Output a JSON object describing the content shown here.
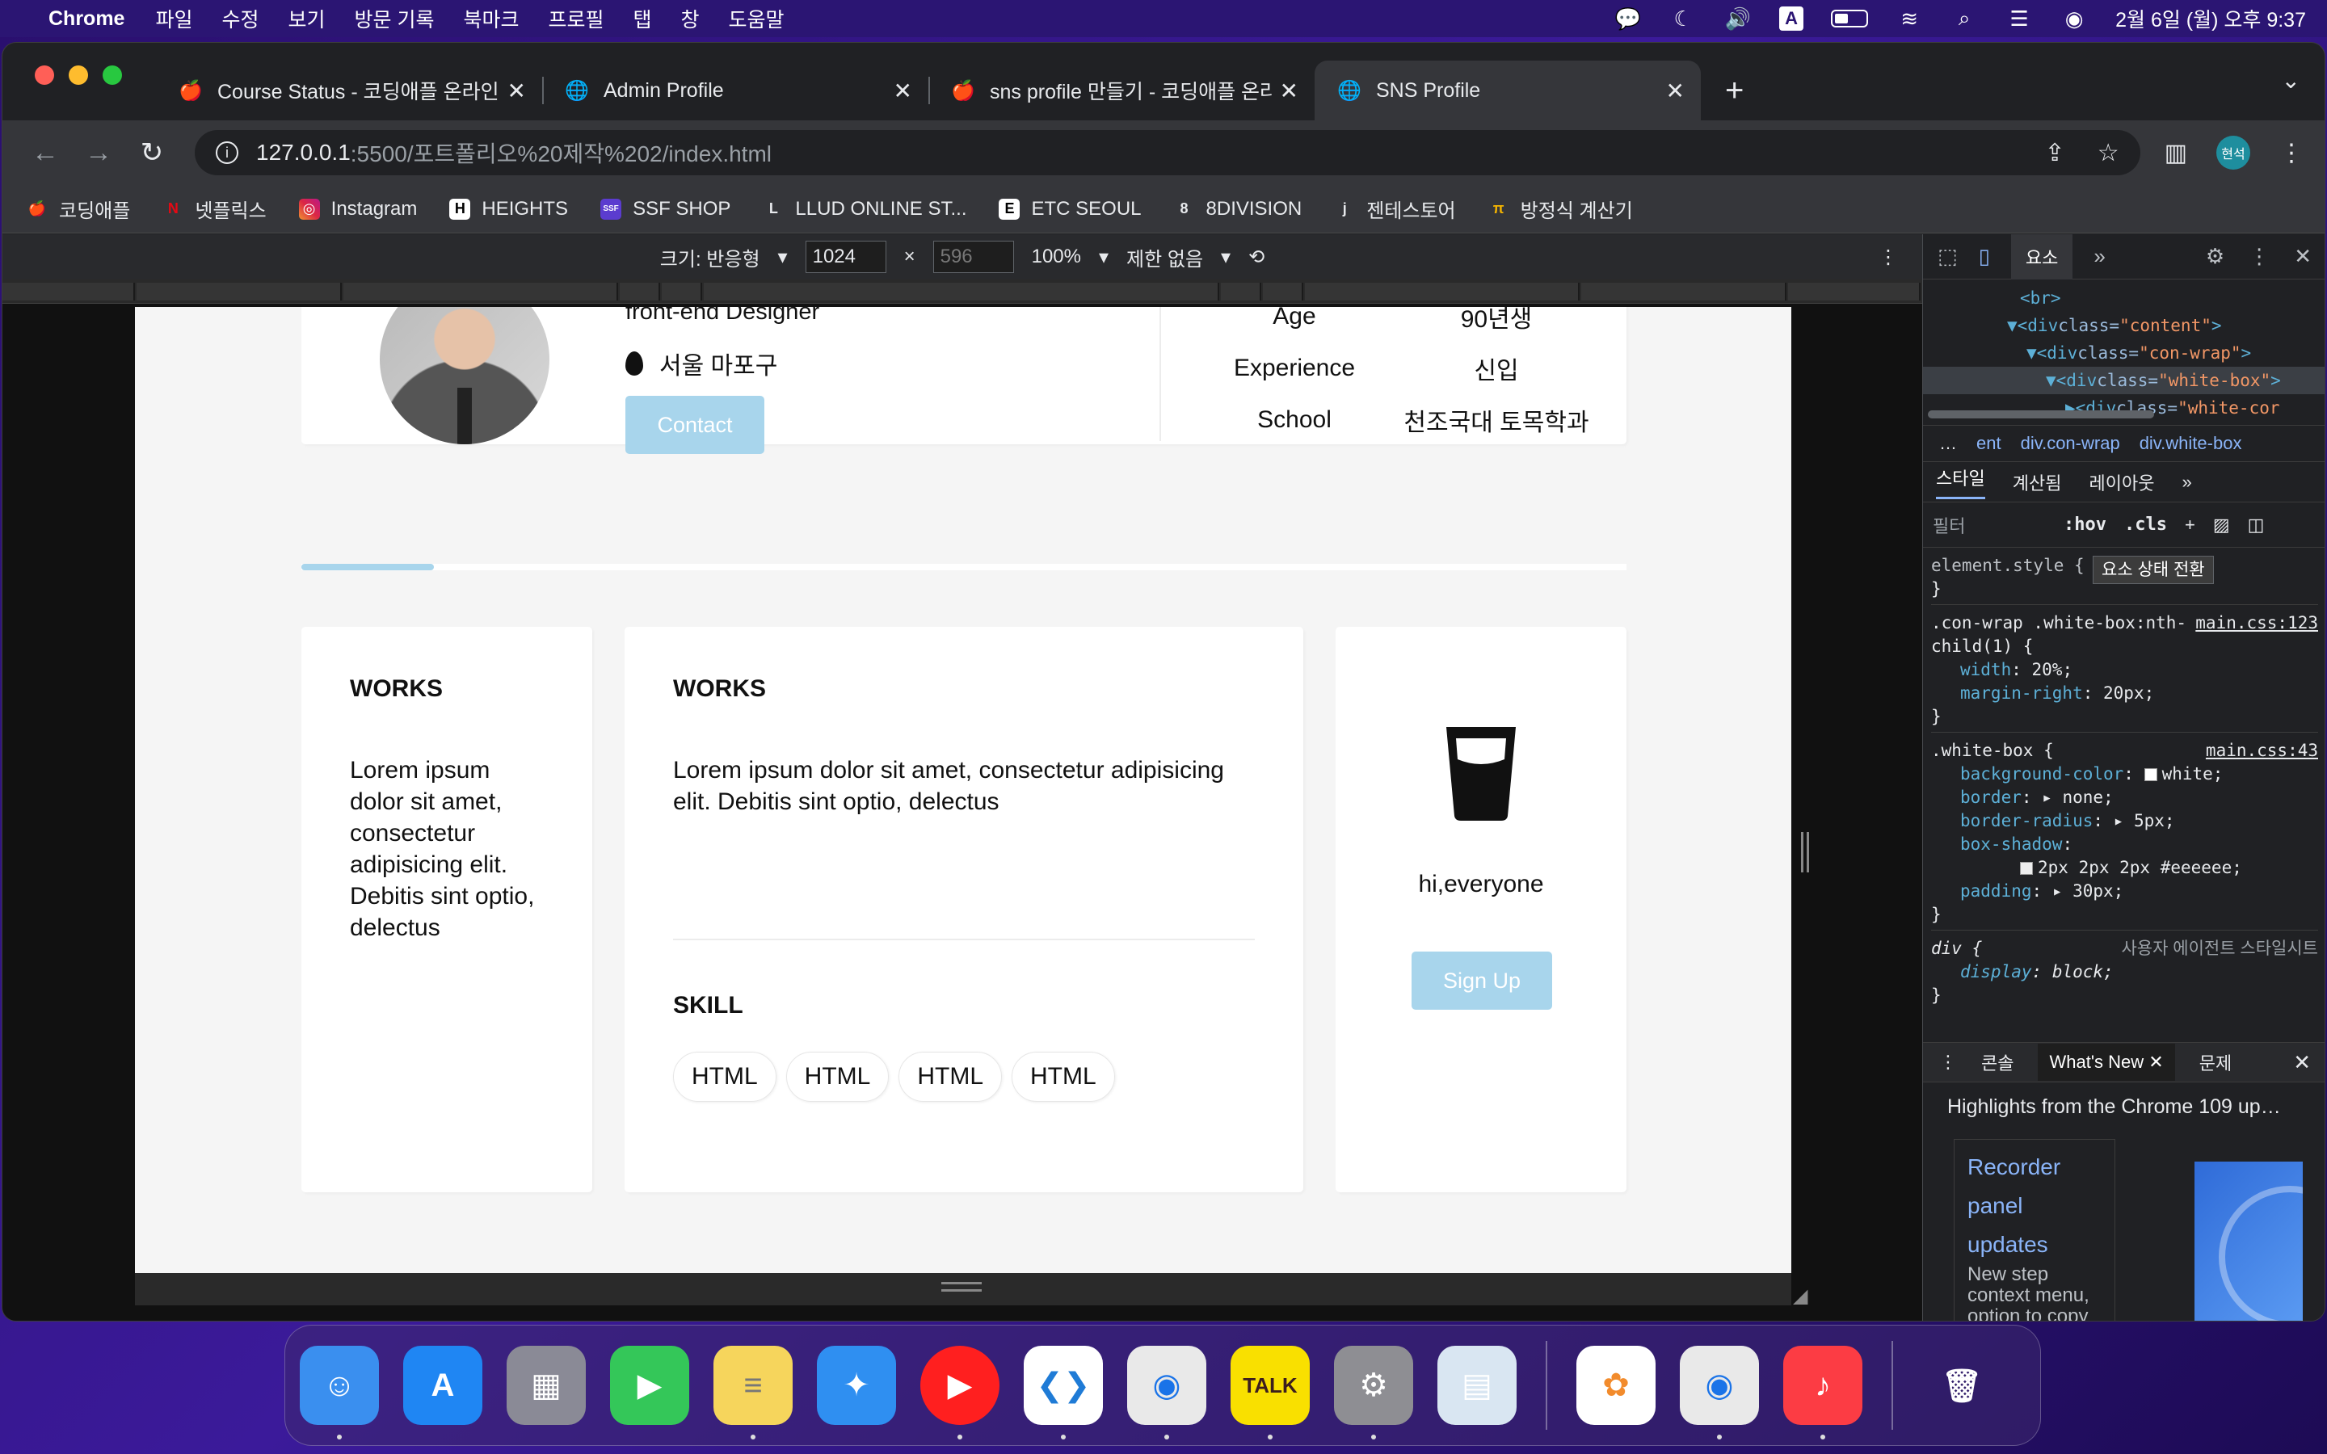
{
  "menubar": {
    "app_name": "Chrome",
    "menus": [
      "파일",
      "수정",
      "보기",
      "방문 기록",
      "북마크",
      "프로필",
      "탭",
      "창",
      "도움말"
    ],
    "clock": "2월 6일 (월) 오후 9:37",
    "input_source": "A"
  },
  "tabs": [
    {
      "title": "Course Status - 코딩애플 온라인",
      "favicon": "apple-favicon"
    },
    {
      "title": "Admin Profile",
      "favicon": "globe-favicon"
    },
    {
      "title": "sns profile 만들기 - 코딩애플 온라",
      "favicon": "apple-favicon"
    },
    {
      "title": "SNS Profile",
      "favicon": "globe-favicon"
    }
  ],
  "address": {
    "host": "127.0.0.1",
    "path": ":5500/포트폴리오%20제작%202/index.html"
  },
  "profile_avatar": "현석",
  "bookmarks": [
    {
      "label": "코딩애플",
      "icon": "🍎",
      "color": "#2b2b2b"
    },
    {
      "label": "넷플릭스",
      "icon": "N",
      "color": "#e50914"
    },
    {
      "label": "Instagram",
      "icon": "◎",
      "color": "#d6249f"
    },
    {
      "label": "HEIGHTS",
      "icon": "H",
      "color": "#ffffff"
    },
    {
      "label": "SSF SHOP",
      "icon": "SSF",
      "color": "#5b3ccf"
    },
    {
      "label": "LLUD ONLINE ST...",
      "icon": "L",
      "color": "#202124"
    },
    {
      "label": "ETC SEOUL",
      "icon": "E",
      "color": "#ffffff"
    },
    {
      "label": "8DIVISION",
      "icon": "8",
      "color": "#202124"
    },
    {
      "label": "젠테스토어",
      "icon": "j",
      "color": "#202124"
    },
    {
      "label": "방정식 계산기",
      "icon": "π",
      "color": "#202124"
    }
  ],
  "device_toolbar": {
    "size_label": "크기: 반응형",
    "width": "1024",
    "height": "596",
    "zoom": "100%",
    "throttle": "제한 없음"
  },
  "page": {
    "role": "front-end Designer",
    "location": "서울 마포구",
    "contact_label": "Contact",
    "info": [
      {
        "key": "Age",
        "value": "90년생"
      },
      {
        "key": "Experience",
        "value": "신입"
      },
      {
        "key": "School",
        "value": "천조국대 토목학과"
      }
    ],
    "progress_fraction": 0.1,
    "box_a": {
      "heading": "WORKS",
      "text": "Lorem ipsum dolor sit amet, consectetur adipisicing elit. Debitis sint optio, delectus"
    },
    "box_b": {
      "heading": "WORKS",
      "text": "Lorem ipsum dolor sit amet, consectetur adipisicing elit. Debitis sint optio, delectus",
      "skill_heading": "SKILL",
      "skills": [
        "HTML",
        "HTML",
        "HTML",
        "HTML"
      ]
    },
    "box_c": {
      "greeting": "hi,everyone",
      "signup_label": "Sign Up"
    }
  },
  "devtools": {
    "panel_tab": "요소",
    "dom": [
      {
        "indent": 0,
        "tag": "<br>"
      },
      {
        "indent": 1,
        "tag": "▼<div ",
        "attr": "class=",
        "val": "\"content\"",
        "end": ">"
      },
      {
        "indent": 2,
        "tag": "▼<div ",
        "attr": "class=",
        "val": "\"con-wrap\"",
        "end": ">"
      },
      {
        "indent": 3,
        "tag": "▼<div ",
        "attr": "class=",
        "val": "\"white-box\"",
        "end": ">"
      },
      {
        "indent": 4,
        "tag": "▶<div ",
        "attr": "class=",
        "val": "\"white-cor",
        "end": ""
      }
    ],
    "breadcrumb": [
      "…",
      "ent",
      "div.con-wrap",
      "div.white-box"
    ],
    "subtabs": [
      "스타일",
      "계산됨",
      "레이아웃"
    ],
    "filter_placeholder": "필터",
    "hov": ":hov",
    "cls": ".cls",
    "tooltip": "요소 상태 전환",
    "rules": [
      {
        "selector": "element.style {",
        "source": "",
        "props": [],
        "close": "}"
      },
      {
        "selector": ".con-wrap .white-box:nth-child(1) {",
        "source": "main.css:123",
        "props": [
          {
            "name": "width",
            "value": "20%;"
          },
          {
            "name": "margin-right",
            "value": "20px;"
          }
        ],
        "close": "}"
      },
      {
        "selector": ".white-box {",
        "source": "main.css:43",
        "props": [
          {
            "name": "background-color",
            "value": "white;"
          },
          {
            "name": "border",
            "value": "▸ none;"
          },
          {
            "name": "border-radius",
            "value": "▸ 5px;"
          },
          {
            "name": "box-shadow",
            "value": ""
          },
          {
            "name": "",
            "value": "2px 2px 2px #eeeeee;"
          },
          {
            "name": "padding",
            "value": "▸ 30px;"
          }
        ],
        "close": "}"
      },
      {
        "selector": "div {",
        "source": "사용자 에이전트 스타일시트",
        "props": [
          {
            "name": "display",
            "value": "block;"
          }
        ],
        "close": "}"
      }
    ],
    "drawer_tabs": [
      "콘솔",
      "What's New",
      "문제"
    ],
    "whats_new_heading": "Highlights from the Chrome 109 up…",
    "recorder_title": "Recorder panel updates",
    "recorder_desc": "New step context menu, option to copy a single step from a"
  },
  "dock": {
    "apps": [
      {
        "name": "finder",
        "glyph": "☺",
        "color": "#3a8fef"
      },
      {
        "name": "app-store",
        "glyph": "A",
        "color": "#1f86f3"
      },
      {
        "name": "launchpad",
        "glyph": "▦",
        "color": "#8a8a96"
      },
      {
        "name": "facetime",
        "glyph": "▶",
        "color": "#34c759"
      },
      {
        "name": "notes",
        "glyph": "≡",
        "color": "#f6d55c"
      },
      {
        "name": "safari",
        "glyph": "✦",
        "color": "#2f8ff1"
      },
      {
        "name": "youtube-music",
        "glyph": "▶",
        "color": "#ff1f1f"
      },
      {
        "name": "vscode",
        "glyph": "❮❯",
        "color": "#ffffff"
      },
      {
        "name": "chrome",
        "glyph": "◉",
        "color": "#e9e9e9"
      },
      {
        "name": "kakaotalk",
        "glyph": "TALK",
        "color": "#f9e000"
      },
      {
        "name": "system-settings",
        "glyph": "⚙",
        "color": "#8e8e93"
      },
      {
        "name": "preview",
        "glyph": "▤",
        "color": "#d9e6f2"
      },
      {
        "name": "photos",
        "glyph": "✿",
        "color": "#ffffff"
      },
      {
        "name": "chrome-2",
        "glyph": "◉",
        "color": "#e9e9e9"
      },
      {
        "name": "music",
        "glyph": "♪",
        "color": "#fc3c44"
      },
      {
        "name": "trash",
        "glyph": "🗑",
        "color": "transparent"
      }
    ]
  }
}
